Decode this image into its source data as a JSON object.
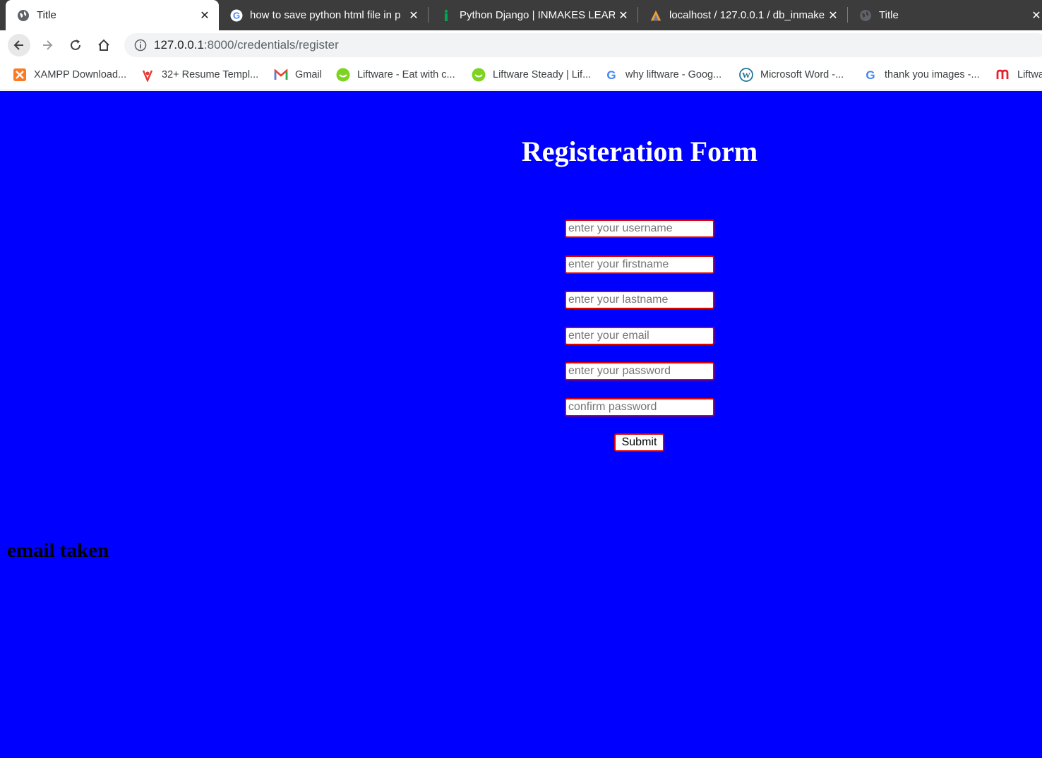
{
  "browser": {
    "tabs": [
      {
        "title": "Title",
        "active": true,
        "icon": "globe-icon"
      },
      {
        "title": "how to save python html file in p",
        "active": false,
        "icon": "google-icon"
      },
      {
        "title": "Python Django | INMAKES LEARN",
        "active": false,
        "icon": "inmakes-icon"
      },
      {
        "title": "localhost / 127.0.0.1 / db_inmake",
        "active": false,
        "icon": "phpmyadmin-icon"
      },
      {
        "title": "Title",
        "active": false,
        "icon": "globe-icon"
      }
    ],
    "close_glyph": "✕",
    "url_host": "127.0.0.1",
    "url_rest": ":8000/credentials/register",
    "bookmarks": [
      {
        "label": "XAMPP Download...",
        "icon": "xampp-icon"
      },
      {
        "label": "32+ Resume Templ...",
        "icon": "resume-icon"
      },
      {
        "label": "Gmail",
        "icon": "gmail-icon"
      },
      {
        "label": "Liftware - Eat with c...",
        "icon": "liftware-icon"
      },
      {
        "label": "Liftware Steady | Lif...",
        "icon": "liftware-icon"
      },
      {
        "label": "why liftware - Goog...",
        "icon": "google-icon"
      },
      {
        "label": "Microsoft Word -...",
        "icon": "wordpress-icon"
      },
      {
        "label": "thank you images -...",
        "icon": "google-icon"
      },
      {
        "label": "Liftwa",
        "icon": "m-icon"
      }
    ]
  },
  "form": {
    "title": "Registeration Form",
    "fields": [
      {
        "name": "username",
        "placeholder": "enter your username",
        "value": ""
      },
      {
        "name": "firstname",
        "placeholder": "enter your firstname",
        "value": ""
      },
      {
        "name": "lastname",
        "placeholder": "enter your lastname",
        "value": ""
      },
      {
        "name": "email",
        "placeholder": "enter your email",
        "value": ""
      },
      {
        "name": "password",
        "placeholder": "enter your password",
        "value": ""
      },
      {
        "name": "confirm",
        "placeholder": "confirm password",
        "value": ""
      }
    ],
    "submit_label": "Submit"
  },
  "message": "email taken",
  "colors": {
    "page_background": "#0000ff",
    "field_border": "#e00000",
    "title_color": "#ffffff",
    "tabstrip": "#3c3c3c"
  }
}
